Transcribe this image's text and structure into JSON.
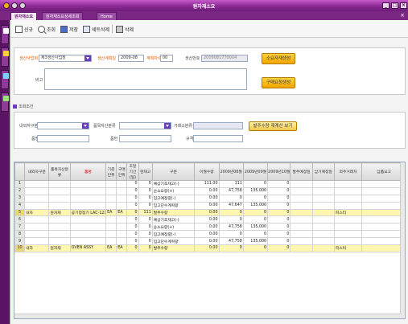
{
  "window": {
    "title": "원자재소요"
  },
  "tabs": [
    {
      "label": "원자재소요"
    },
    {
      "label": "원자재소요상세조회"
    },
    {
      "label": "Home"
    }
  ],
  "toolbar": {
    "new_label": "신규",
    "search_label": "조회",
    "save_label": "저장",
    "row_delete_label": "세트삭제",
    "delete_label": "삭제"
  },
  "form": {
    "plan_project_label": "생산사업회",
    "plan_project_value": "제3생산사업장",
    "plan_year_label": "생산계획일",
    "plan_year_value": "2009-08",
    "plan_count_label": "계획차수",
    "plan_count_value": "00",
    "plan_no_label": "생산번호",
    "plan_no_value": "2009081770004",
    "note_label": "비고",
    "btn_create": "소요자재생성",
    "btn_delete_calc": "구매요청생성"
  },
  "filter": {
    "section_label": "조회조건",
    "mgmt_label": "내외자구분",
    "item_class_label": "품목자산분류",
    "vendor_label": "거래소분류",
    "name_label": "품명",
    "spec_label": "품번",
    "std_label": "규격",
    "btn_refresh": "발주수량 재계산 보기"
  },
  "grid": {
    "headers": [
      "내외자구분",
      "품목자산분류",
      "품명",
      "기준단위",
      "구매단위",
      "조달기간(일)",
      "현재고",
      "구분",
      "이월수량",
      "2009년08월",
      "2009년09월",
      "2009년10월",
      "발주예정일",
      "납기예정일",
      "외주거래처",
      "납품요고"
    ],
    "rows": [
      {
        "no": "1",
        "c1": "",
        "c2": "",
        "c3": "",
        "c4": "",
        "c5": "",
        "c6": "0",
        "c7": "0",
        "c8": "예상기초재고(-)",
        "c9": "111.00",
        "c10": "111",
        "c11": "0",
        "c12": "0",
        "c13": "",
        "c14": "",
        "c15": "",
        "c16": "",
        "hl": false
      },
      {
        "no": "2",
        "c1": "",
        "c2": "",
        "c3": "",
        "c4": "",
        "c5": "",
        "c6": "0",
        "c7": "0",
        "c8": "순소요량(+)",
        "c9": "0.00",
        "c10": "47,758",
        "c11": "135,000",
        "c12": "0",
        "c13": "",
        "c14": "",
        "c15": "",
        "c16": "",
        "hl": false
      },
      {
        "no": "3",
        "c1": "",
        "c2": "",
        "c3": "",
        "c4": "",
        "c5": "",
        "c6": "0",
        "c7": "0",
        "c8": "입고예정량(-)",
        "c9": "0.00",
        "c10": "0",
        "c11": "0",
        "c12": "0",
        "c13": "",
        "c14": "",
        "c15": "",
        "c16": "",
        "hl": false
      },
      {
        "no": "4",
        "c1": "",
        "c2": "",
        "c3": "",
        "c4": "",
        "c5": "",
        "c6": "0",
        "c7": "0",
        "c8": "입고단수계획량",
        "c9": "0.00",
        "c10": "47,647",
        "c11": "135,000",
        "c12": "0",
        "c13": "",
        "c14": "",
        "c15": "",
        "c16": "",
        "hl": false
      },
      {
        "no": "5",
        "c1": "내자",
        "c2": "원자재",
        "c3": "공기청정기 LAC-1215",
        "c4": "EA",
        "c5": "EA",
        "c6": "0",
        "c7": "111",
        "c8": "발주수량",
        "c9": "0.00",
        "c10": "0",
        "c11": "0",
        "c12": "0",
        "c13": "",
        "c14": "",
        "c15": "피스티",
        "c16": "",
        "hl": true
      },
      {
        "no": "6",
        "c1": "",
        "c2": "",
        "c3": "",
        "c4": "",
        "c5": "",
        "c6": "0",
        "c7": "0",
        "c8": "예상기초재고(-)",
        "c9": "0.00",
        "c10": "0",
        "c11": "0",
        "c12": "0",
        "c13": "",
        "c14": "",
        "c15": "",
        "c16": "",
        "hl": false
      },
      {
        "no": "7",
        "c1": "",
        "c2": "",
        "c3": "",
        "c4": "",
        "c5": "",
        "c6": "0",
        "c7": "0",
        "c8": "순소요량(+)",
        "c9": "0.00",
        "c10": "47,758",
        "c11": "135,000",
        "c12": "0",
        "c13": "",
        "c14": "",
        "c15": "",
        "c16": "",
        "hl": false
      },
      {
        "no": "8",
        "c1": "",
        "c2": "",
        "c3": "",
        "c4": "",
        "c5": "",
        "c6": "0",
        "c7": "0",
        "c8": "입고예정량(-)",
        "c9": "0.00",
        "c10": "0",
        "c11": "0",
        "c12": "0",
        "c13": "",
        "c14": "",
        "c15": "",
        "c16": "",
        "hl": false
      },
      {
        "no": "9",
        "c1": "",
        "c2": "",
        "c3": "",
        "c4": "",
        "c5": "",
        "c6": "0",
        "c7": "0",
        "c8": "입고단수계획량",
        "c9": "0.00",
        "c10": "47,758",
        "c11": "135,000",
        "c12": "0",
        "c13": "",
        "c14": "",
        "c15": "",
        "c16": "",
        "hl": false
      },
      {
        "no": "10",
        "c1": "내자",
        "c2": "원자재",
        "c3": "OVEN ASSY",
        "c4": "EA",
        "c5": "EA",
        "c6": "0",
        "c7": "0",
        "c8": "발주수량",
        "c9": "0.00",
        "c10": "0",
        "c11": "0",
        "c12": "0",
        "c13": "",
        "c14": "",
        "c15": "피스티",
        "c16": "",
        "hl": true
      }
    ]
  },
  "colors": {
    "chrome": "#8b2a93",
    "button_orange": "#f3a400",
    "highlight_row": "#fff6b0"
  }
}
